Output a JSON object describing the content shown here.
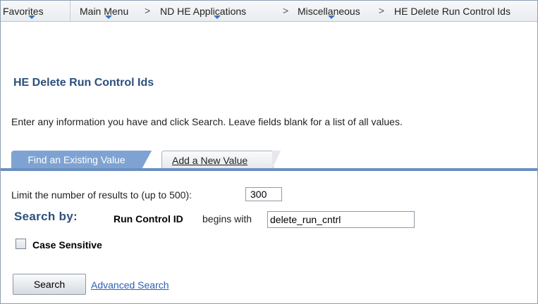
{
  "nav": {
    "favorites": "Favorites",
    "main_menu": "Main Menu",
    "nd_he_applications": "ND HE Applications",
    "miscellaneous": "Miscellaneous",
    "current": "HE Delete Run Control Ids",
    "separator": ">"
  },
  "page": {
    "title": "HE Delete Run Control Ids",
    "instructions": "Enter any information you have and click Search. Leave fields blank for a list of all values."
  },
  "tabs": [
    {
      "label": "Find an Existing Value",
      "active": true
    },
    {
      "label": "Add a New Value",
      "active": false
    }
  ],
  "form": {
    "limit_label": "Limit the number of results to (up to 500):",
    "limit_value": "300",
    "search_by_label": "Search by:",
    "field_label": "Run Control ID",
    "operator_text": "begins with",
    "run_control_value": "delete_run_cntrl",
    "case_sensitive_label": "Case Sensitive",
    "case_sensitive_checked": false
  },
  "actions": {
    "search_label": "Search",
    "advanced_search_label": "Advanced Search"
  },
  "colors": {
    "title": "#2e4f7e",
    "active_tab": "#7ea3d2",
    "link": "#2b5fb4"
  }
}
